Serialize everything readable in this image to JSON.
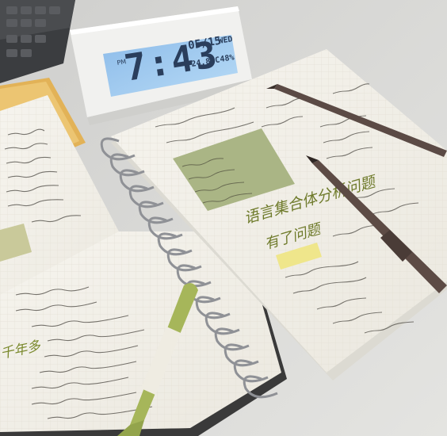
{
  "clock": {
    "time": "7:43",
    "date": "05/15",
    "weekday": "WED",
    "temperature": "24.8°C",
    "humidity": "48%",
    "am_pm": "PM"
  },
  "notebook_right": {
    "heading": "语言集合体分析问题",
    "heading_line2": "有了问题",
    "sticky_note": "",
    "highlight": ""
  },
  "notebook_left": {
    "side_title": "千年多"
  },
  "colors": {
    "desk": "#d9d9d7",
    "paper": "#f3f1ea",
    "sticky_note": "#aeb88a",
    "highlighter_yellow": "#efe68b",
    "pen_green": "#a8b85a",
    "pen_brown": "#5b4a45",
    "clock_screen": "#9fc9ef",
    "tray_orange": "#e4b45c",
    "ink_green": "#6e7a2a"
  },
  "icons": [
    "alarm-clock",
    "spiral-binding",
    "highlighter-pen",
    "fineliner-pen"
  ]
}
